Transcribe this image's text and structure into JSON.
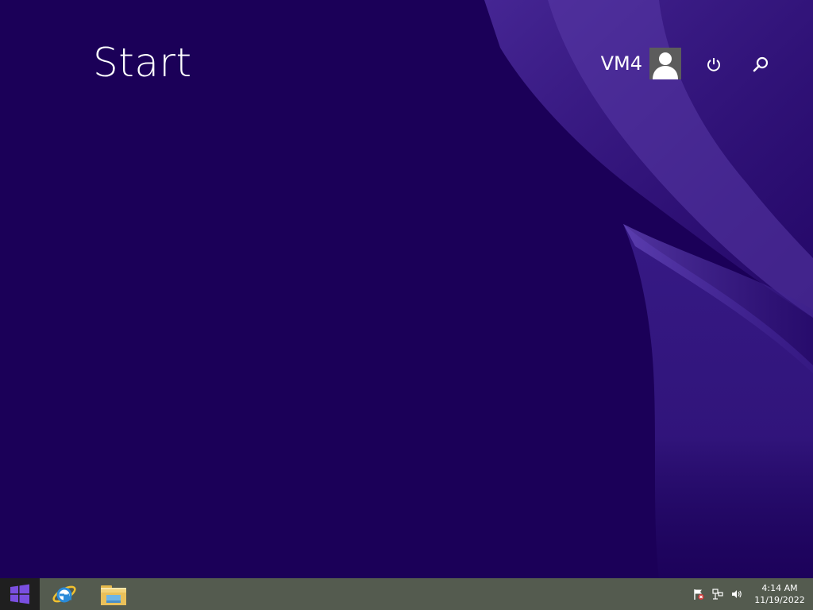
{
  "start_screen": {
    "title": "Start",
    "user_name": "VM4"
  },
  "taskbar": {
    "clock": {
      "time": "4:14 AM",
      "date": "11/19/2022"
    },
    "pinned": [
      "internet-explorer-icon",
      "file-explorer-icon"
    ],
    "tray_icons": [
      "action-center-flag-icon",
      "network-icon",
      "volume-icon"
    ]
  },
  "colors": {
    "background": "#1b0058",
    "swoosh": "#5a3aa8",
    "taskbar": "#545b4f",
    "start_button": "#1f1f1f",
    "windows_logo": "#7a4fe0",
    "text": "#ffffff"
  }
}
